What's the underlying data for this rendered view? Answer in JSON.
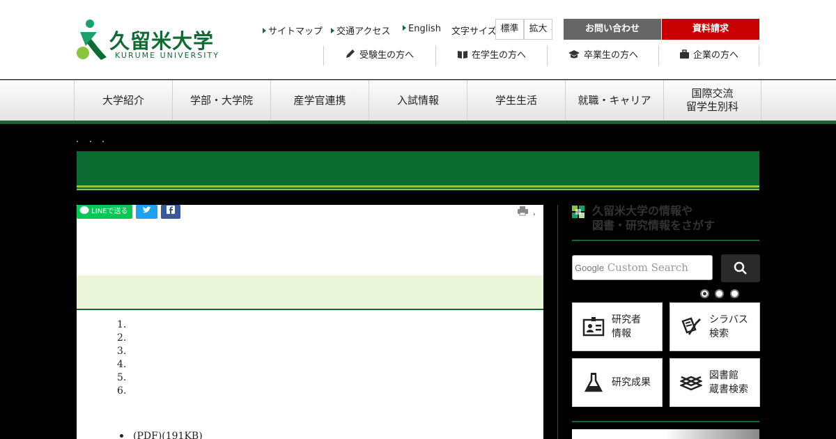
{
  "logo": {
    "name": "久留米大学",
    "sub": "KURUME UNIVERSITY"
  },
  "util_links": [
    {
      "label": "サイトマップ"
    },
    {
      "label": "交通アクセス"
    },
    {
      "label": "English"
    }
  ],
  "font_size": {
    "label": "文字サイズ",
    "standard": "標準",
    "large": "拡大"
  },
  "buttons": {
    "contact": "お問い合わせ",
    "request": "資料請求"
  },
  "audience": [
    {
      "label": "受験生の方へ",
      "icon": "pencil-icon"
    },
    {
      "label": "在学生の方へ",
      "icon": "book-icon"
    },
    {
      "label": "卒業生の方へ",
      "icon": "graduation-cap-icon"
    },
    {
      "label": "企業の方へ",
      "icon": "briefcase-icon"
    }
  ],
  "gnav": [
    {
      "label": "大学紹介"
    },
    {
      "label": "学部・大学院"
    },
    {
      "label": "産学官連携"
    },
    {
      "label": "入試情報"
    },
    {
      "label": "学生生活"
    },
    {
      "label": "就職・キャリア"
    },
    {
      "label": "国際交流\n留学生別科"
    }
  ],
  "share": {
    "line": "LINEで送る"
  },
  "ordered_list": [
    "1.",
    "2.",
    "3.",
    "4.",
    "5.",
    "6."
  ],
  "bullet_item": "(PDF)(191KB)",
  "sidebar": {
    "title_line1": "久留米大学の情報や",
    "title_line2": "図書・研究情報をさがす",
    "search_brand": "Google",
    "search_placeholder": "Custom Search",
    "tiles": [
      {
        "label": "研究者\n情報",
        "icon": "researcher-id-icon"
      },
      {
        "label": "シラバス\n検索",
        "icon": "syllabus-pen-icon"
      },
      {
        "label": "研究成果",
        "icon": "flask-icon"
      },
      {
        "label": "図書館\n蔵書検索",
        "icon": "books-stack-icon"
      }
    ]
  },
  "colors": {
    "brand_green": "#0f6b34",
    "accent_light_green": "#8bc53f",
    "request_red": "#c80000",
    "contact_gray": "#666666"
  }
}
